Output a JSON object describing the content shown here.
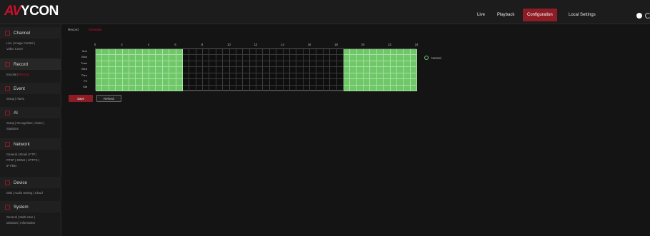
{
  "brand": {
    "logo_accent": "AV",
    "logo_rest": "YCON",
    "accent_color": "#c8102e"
  },
  "nav": {
    "items": [
      {
        "label": "Live",
        "active": false
      },
      {
        "label": "Playback",
        "active": false
      },
      {
        "label": "Configuration",
        "active": true
      },
      {
        "label": "Local Settings",
        "active": false
      }
    ]
  },
  "sidebar": {
    "sections": [
      {
        "title": "Channel",
        "icon": "camera-icon",
        "active": false,
        "links": [
          "Live",
          "|",
          "Image Control",
          "|",
          "Video Cover"
        ]
      },
      {
        "title": "Record",
        "icon": "record-icon",
        "active": true,
        "links": [
          "Encode",
          "|",
          "Record"
        ]
      },
      {
        "title": "Event",
        "icon": "event-icon",
        "active": false,
        "links": [
          "Setup",
          "|",
          "Alarm"
        ]
      },
      {
        "title": "AI",
        "icon": "ai-icon",
        "active": false,
        "links": [
          "Setup",
          "|",
          "Recognition",
          "|",
          "Alarm",
          "|",
          "Statistics"
        ]
      },
      {
        "title": "Network",
        "icon": "network-icon",
        "active": false,
        "links": [
          "General",
          "|",
          "Email",
          "|",
          "FTP",
          "|",
          "RTSP",
          "|",
          "DDNS",
          "|",
          "HTTPS",
          "|",
          "IP Filter"
        ]
      },
      {
        "title": "Device",
        "icon": "device-icon",
        "active": false,
        "links": [
          "Disk",
          "|",
          "Audio Setting",
          "|",
          "Cloud"
        ]
      },
      {
        "title": "System",
        "icon": "system-icon",
        "active": false,
        "links": [
          "General",
          "|",
          "Multi-User",
          "|",
          "Maintain",
          "|",
          "Information"
        ]
      }
    ]
  },
  "tabs": [
    {
      "label": "Record",
      "active": false
    },
    {
      "label": "Schedule",
      "active": true
    }
  ],
  "schedule": {
    "hours": [
      "0",
      "2",
      "4",
      "6",
      "8",
      "10",
      "12",
      "14",
      "16",
      "18",
      "20",
      "22",
      "24"
    ],
    "days": [
      "Sun",
      "Mon",
      "Tues",
      "Wed",
      "Thur",
      "Fri",
      "Sat"
    ],
    "enabled_ranges": [
      [
        0,
        6.5
      ],
      [
        18.5,
        24
      ]
    ],
    "active_color": "#70c76a"
  },
  "legend": {
    "label": "Normal",
    "icon": "normal-icon"
  },
  "buttons": {
    "save": "Save",
    "refresh": "Refresh"
  }
}
